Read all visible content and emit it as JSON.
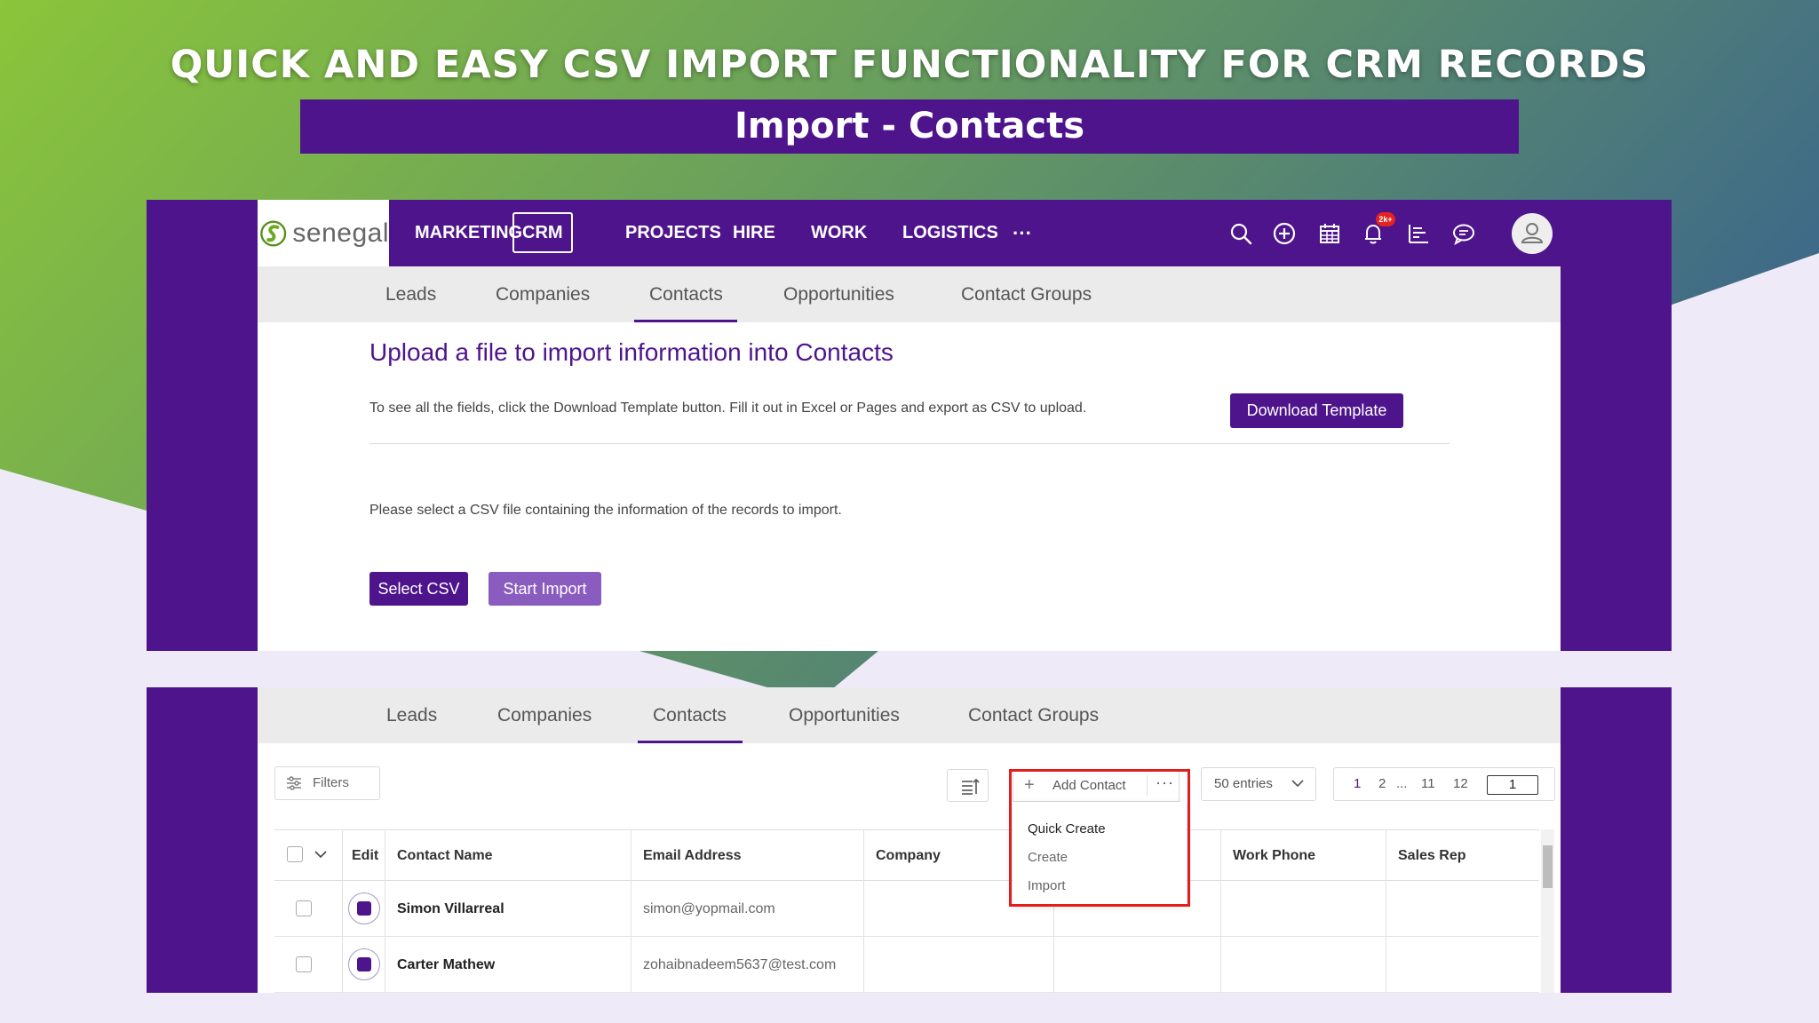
{
  "headline": "QUICK AND EASY CSV IMPORT FUNCTIONALITY FOR CRM RECORDS",
  "subheadline": "Import - Contacts",
  "colors": {
    "brand_purple": "#4e148c",
    "start_import": "#8a5cc0",
    "highlight_red": "#e31c1c",
    "badge_red": "#e52222"
  },
  "app": {
    "logo_text": "senegal",
    "nav": [
      "MARKETING",
      "CRM",
      "PROJECTS",
      "HIRE",
      "WORK",
      "LOGISTICS"
    ],
    "nav_more": "···",
    "nav_active": "CRM",
    "icons": [
      "search-icon",
      "plus-circle-icon",
      "calendar-icon",
      "bell-icon",
      "chart-icon",
      "chat-icon",
      "user-avatar-icon"
    ],
    "notification_badge": "2k+"
  },
  "subnav": {
    "items": [
      "Leads",
      "Companies",
      "Contacts",
      "Opportunities",
      "Contact Groups"
    ],
    "active": "Contacts"
  },
  "upload": {
    "title": "Upload a file to import information into Contacts",
    "help": "To see all the fields, click the Download Template button. Fill it out in Excel or Pages and export as CSV to upload.",
    "download_label": "Download Template",
    "select_prompt": "Please select a CSV file containing the information of the records to import.",
    "select_label": "Select CSV",
    "start_label": "Start Import"
  },
  "list": {
    "filters_label": "Filters",
    "add_contact_label": "Add Contact",
    "add_more": "···",
    "dropdown": [
      "Quick Create",
      "Create",
      "Import"
    ],
    "entries_label": "50 entries",
    "pagination": [
      "1",
      "2",
      "...",
      "11",
      "12"
    ],
    "current_page": "1",
    "columns": [
      "Edit",
      "Contact Name",
      "Email Address",
      "Company",
      "Work Phone",
      "Sales Rep"
    ],
    "rows": [
      {
        "name": "Simon Villarreal",
        "email": "simon@yopmail.com"
      },
      {
        "name": "Carter Mathew",
        "email": "zohaibnadeem5637@test.com"
      }
    ]
  }
}
